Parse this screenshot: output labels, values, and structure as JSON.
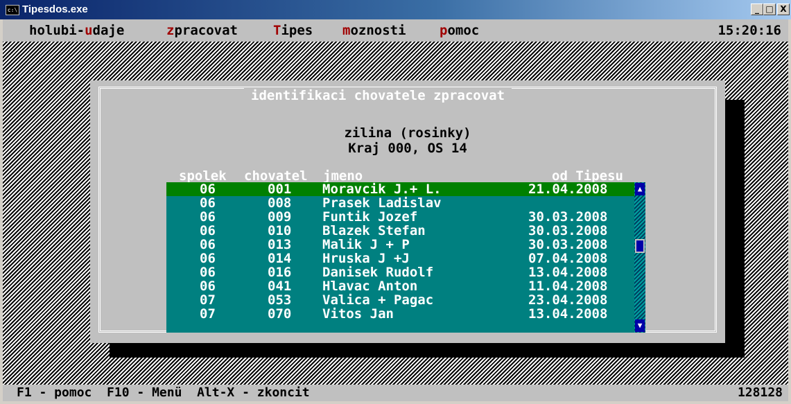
{
  "window": {
    "title": "Tipesdos.exe",
    "icon_text": "c:\\",
    "minimize_glyph": "_",
    "maximize_glyph": "□",
    "close_glyph": "X"
  },
  "menu": {
    "items": [
      {
        "hot": "",
        "before": "holubi-",
        "key": "u",
        "after": "daje",
        "label": "holubi-udaje"
      },
      {
        "before": "",
        "key": "z",
        "after": "pracovat",
        "label": "zpracovat"
      },
      {
        "before": "",
        "key": "T",
        "after": "ipes",
        "label": "Tipes"
      },
      {
        "before": "",
        "key": "m",
        "after": "oznosti",
        "label": "moznosti"
      },
      {
        "before": "",
        "key": "p",
        "after": "omoc",
        "label": "pomoc"
      }
    ],
    "clock": "15:20:16"
  },
  "dialog": {
    "title": "identifikaci chovatele zpracovat",
    "location_line1": "zilina (rosinky)",
    "location_line2": "Kraj 000, OS 14",
    "headers": {
      "spolek": "spolek",
      "chovatel": "chovatel",
      "jmeno": "jmeno",
      "od_tipesu": "od Tipesu"
    },
    "rows": [
      {
        "spolek": "06",
        "chovatel": "001",
        "jmeno": "Moravcik J.+ L.",
        "od": "21.04.2008",
        "selected": true
      },
      {
        "spolek": "06",
        "chovatel": "008",
        "jmeno": "Prasek Ladislav",
        "od": ""
      },
      {
        "spolek": "06",
        "chovatel": "009",
        "jmeno": "Funtik Jozef",
        "od": "30.03.2008"
      },
      {
        "spolek": "06",
        "chovatel": "010",
        "jmeno": "Blazek Stefan",
        "od": "30.03.2008"
      },
      {
        "spolek": "06",
        "chovatel": "013",
        "jmeno": "Malik J + P",
        "od": "30.03.2008"
      },
      {
        "spolek": "06",
        "chovatel": "014",
        "jmeno": "Hruska J +J",
        "od": "07.04.2008"
      },
      {
        "spolek": "06",
        "chovatel": "016",
        "jmeno": "Danisek Rudolf",
        "od": "13.04.2008"
      },
      {
        "spolek": "06",
        "chovatel": "041",
        "jmeno": "Hlavac Anton",
        "od": "11.04.2008"
      },
      {
        "spolek": "07",
        "chovatel": "053",
        "jmeno": "Valica + Pagac",
        "od": "23.04.2008"
      },
      {
        "spolek": "07",
        "chovatel": "070",
        "jmeno": "Vitos Jan",
        "od": "13.04.2008"
      }
    ],
    "scroll_up_glyph": "▲",
    "scroll_down_glyph": "▼"
  },
  "status": {
    "text": "F1 - pomoc  F10 - Menü  Alt-X - zkoncit",
    "number": "128128"
  },
  "colors": {
    "list_bg": "#008080",
    "selected_bg": "#008000",
    "dialog_bg": "#c0c0c0",
    "hotkey": "#a00000",
    "scroll": "#0000a8"
  }
}
